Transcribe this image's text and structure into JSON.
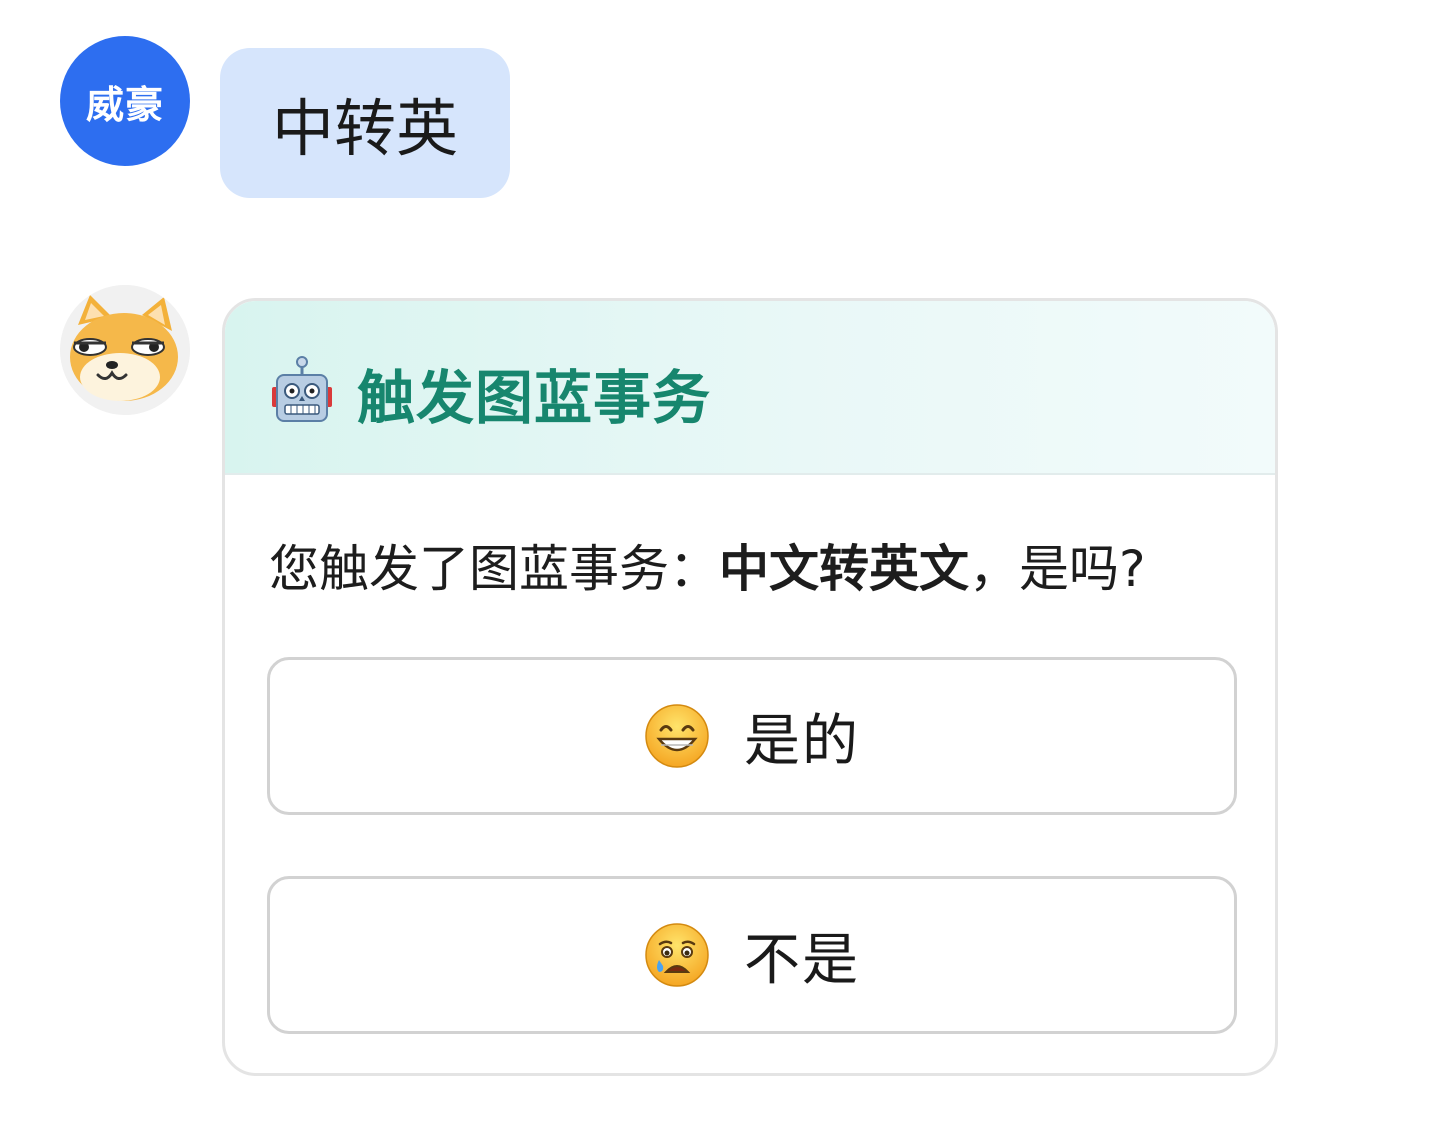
{
  "user_message": {
    "avatar_text": "威豪",
    "text": "中转英",
    "avatar_color": "#2d6ef0",
    "bubble_color": "#d6e5fc"
  },
  "bot": {
    "avatar_icon": "shiba-dog-face-icon",
    "card": {
      "title_icon": "robot-icon",
      "title": "触发图蓝事务",
      "title_color": "#17866e",
      "question_prefix": "您触发了图蓝事务：",
      "question_bold": "中文转英文",
      "question_suffix": "，是吗?",
      "options": [
        {
          "icon": "grinning-face-emoji-icon",
          "label": "是的"
        },
        {
          "icon": "crying-face-emoji-icon",
          "label": "不是"
        }
      ]
    }
  }
}
